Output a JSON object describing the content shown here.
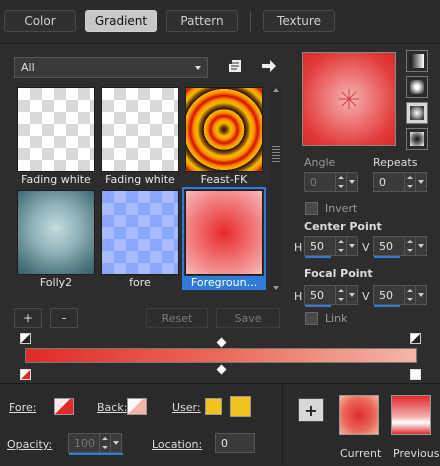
{
  "tabs": [
    {
      "label": "Color",
      "active": false
    },
    {
      "label": "Gradient",
      "active": true
    },
    {
      "label": "Pattern",
      "active": false
    },
    {
      "label": "Texture",
      "active": false
    }
  ],
  "filter": {
    "selected": "All"
  },
  "gradients": [
    {
      "label": "Fading white",
      "selected": false
    },
    {
      "label": "Fading white",
      "selected": false
    },
    {
      "label": "Feast-FK",
      "selected": false
    },
    {
      "label": "Folly2",
      "selected": false
    },
    {
      "label": "fore",
      "selected": false
    },
    {
      "label": "Foregroun...",
      "selected": true
    }
  ],
  "list_buttons": {
    "add": "+",
    "remove": "-",
    "reset": "Reset",
    "save": "Save"
  },
  "angle": {
    "label": "Angle",
    "value": "0"
  },
  "repeats": {
    "label": "Repeats",
    "value": "0"
  },
  "invert": {
    "label": "Invert",
    "checked": false
  },
  "center_point": {
    "label": "Center Point",
    "h_label": "H",
    "h": "50",
    "v_label": "V",
    "v": "50"
  },
  "focal_point": {
    "label": "Focal Point",
    "h_label": "H",
    "h": "50",
    "v_label": "V",
    "v": "50"
  },
  "link": {
    "label": "Link",
    "checked": false
  },
  "colors": {
    "fore_label": "Fore:",
    "back_label": "Back:",
    "user_label": "User:",
    "fore": "#e02a2a",
    "back": "#f4b6a8",
    "user": "#f2c21e",
    "accent": "#2f7bd8"
  },
  "opacity": {
    "label": "Opacity:",
    "value": "100"
  },
  "location": {
    "label": "Location:",
    "value": "0"
  },
  "current_label": "Current",
  "previous_label": "Previous",
  "add_button_label": "+"
}
